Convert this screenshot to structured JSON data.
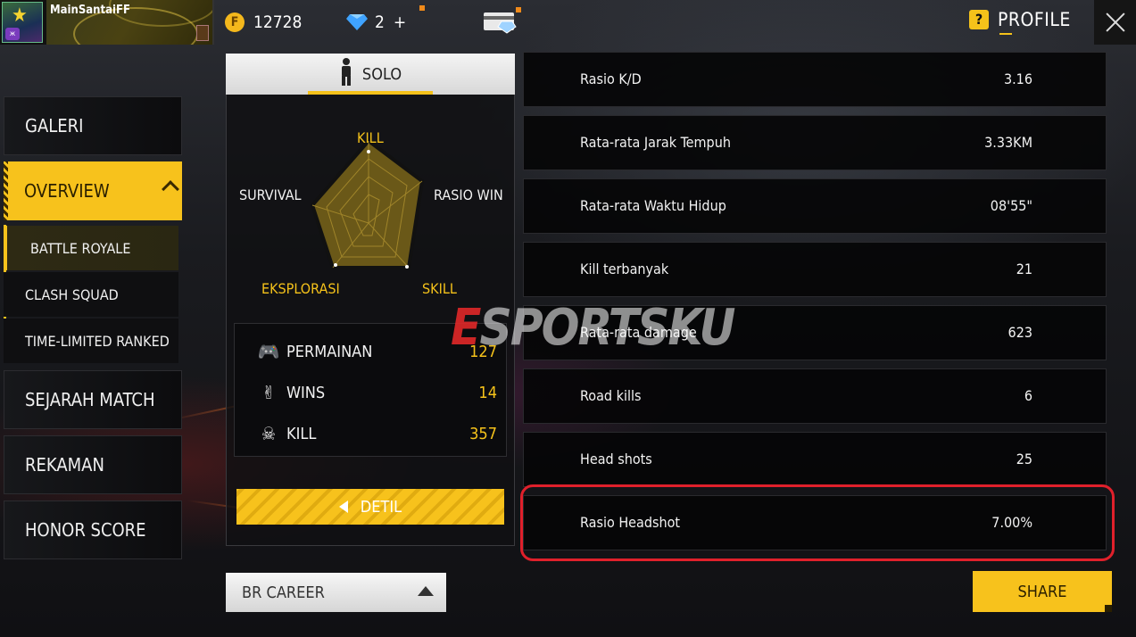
{
  "header": {
    "player_name": "MainSantaiFF",
    "coins": "12728",
    "diamonds": "2",
    "profile_label": "PROFILE",
    "help_label": "?"
  },
  "sidebar": {
    "items": [
      {
        "label": "GALERI"
      },
      {
        "label": "OVERVIEW"
      },
      {
        "label": "SEJARAH MATCH"
      },
      {
        "label": "REKAMAN"
      },
      {
        "label": "HONOR SCORE"
      }
    ],
    "subitems": [
      {
        "label": "BATTLE ROYALE"
      },
      {
        "label": "CLASH SQUAD"
      },
      {
        "label": "TIME-LIMITED RANKED"
      }
    ]
  },
  "mode_tab": {
    "label": "SOLO"
  },
  "radar": {
    "labels": {
      "kill": "KILL",
      "rasio_win": "RASIO WIN",
      "skill": "SKILL",
      "eksplorasi": "EKSPLORASI",
      "survival": "SURVIVAL"
    }
  },
  "summary": {
    "rows": [
      {
        "label": "PERMAINAN",
        "value": "127",
        "icon": "gamepad-icon"
      },
      {
        "label": "WINS",
        "value": "14",
        "icon": "victory-hand-icon"
      },
      {
        "label": "KILL",
        "value": "357",
        "icon": "skull-icon"
      }
    ]
  },
  "detil_label": "DETIL",
  "career_select": {
    "label": "BR CAREER"
  },
  "stats": [
    {
      "label": "Rasio K/D",
      "value": "3.16"
    },
    {
      "label": "Rata-rata Jarak Tempuh",
      "value": "3.33KM"
    },
    {
      "label": "Rata-rata Waktu Hidup",
      "value": "08'55\""
    },
    {
      "label": "Kill terbanyak",
      "value": "21"
    },
    {
      "label": "Rata-rata damage",
      "value": "623"
    },
    {
      "label": "Road kills",
      "value": "6"
    },
    {
      "label": "Head shots",
      "value": "25"
    },
    {
      "label": "Rasio Headshot",
      "value": "7.00%"
    }
  ],
  "share_label": "SHARE",
  "watermark": {
    "e": "E",
    "rest": "SPORTSKU"
  },
  "colors": {
    "accent": "#f7c21c",
    "highlight": "#e0202b"
  }
}
